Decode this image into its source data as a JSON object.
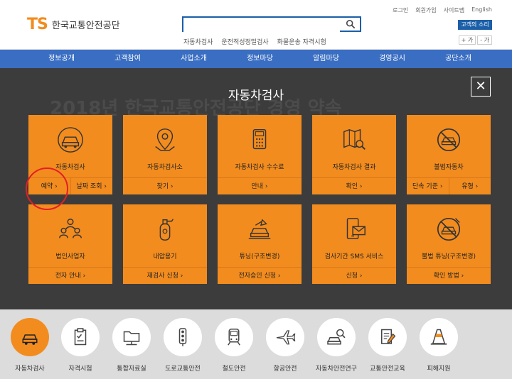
{
  "header": {
    "logo_mark": "TS",
    "logo_name": "한국교통안전공단",
    "search_value": "",
    "keywords": [
      "자동차검사",
      "운전적성정밀검사",
      "화물운송 자격시험"
    ],
    "util_links": [
      "로그인",
      "회원가입",
      "사이트맵",
      "English"
    ],
    "voice_button": "고객의 소리",
    "font_plus": "+ 가",
    "font_minus": "- 가"
  },
  "nav": [
    "정보공개",
    "고객참여",
    "사업소개",
    "정보마당",
    "알림마당",
    "경영공시",
    "공단소개"
  ],
  "overlay": {
    "background_text": "2018년 한국교통안전공단 경영 약속",
    "title": "자동차검사",
    "close_symbol": "✕",
    "tiles": [
      {
        "title": "자동차검사",
        "icon": "car-inspection-icon",
        "links": [
          "예약 ›",
          "날짜 조회 ›"
        ]
      },
      {
        "title": "자동차검사소",
        "icon": "map-pin-icon",
        "links": [
          "찾기 ›"
        ]
      },
      {
        "title": "자동차검사 수수료",
        "icon": "calculator-icon",
        "links": [
          "안내 ›"
        ]
      },
      {
        "title": "자동차검사 결과",
        "icon": "map-search-icon",
        "links": [
          "확인 ›"
        ]
      },
      {
        "title": "불법자동차",
        "icon": "no-car-icon",
        "links": [
          "단속 기준 ›",
          "유형 ›"
        ]
      },
      {
        "title": "법인사업자",
        "icon": "people-icon",
        "links": [
          "전자 안내 ›"
        ]
      },
      {
        "title": "내압용기",
        "icon": "gas-cylinder-icon",
        "links": [
          "재검사 신청 ›"
        ]
      },
      {
        "title": "튜닝(구조변경)",
        "icon": "tuning-car-icon",
        "links": [
          "전자승인 신청 ›"
        ]
      },
      {
        "title": "검사기간 SMS 서비스",
        "icon": "phone-mail-icon",
        "links": [
          "신청 ›"
        ]
      },
      {
        "title": "불법 튜닝(구조변경)",
        "icon": "no-tuning-icon",
        "links": [
          "확인 방법 ›"
        ]
      }
    ]
  },
  "quick_menu": [
    {
      "label": "자동차검사",
      "icon": "car-inspection-icon",
      "active": true
    },
    {
      "label": "자격시험",
      "icon": "clipboard-icon",
      "active": false
    },
    {
      "label": "통합자료실",
      "icon": "folder-network-icon",
      "active": false
    },
    {
      "label": "도로교통안전",
      "icon": "traffic-light-icon",
      "active": false
    },
    {
      "label": "철도안전",
      "icon": "train-icon",
      "active": false
    },
    {
      "label": "항공안전",
      "icon": "airplane-icon",
      "active": false
    },
    {
      "label": "자동차안전연구",
      "icon": "car-search-icon",
      "active": false
    },
    {
      "label": "교통안전교육",
      "icon": "document-edit-icon",
      "active": false
    },
    {
      "label": "피해지원",
      "icon": "traffic-cone-icon",
      "active": false
    }
  ],
  "colors": {
    "brand_blue": "#1b5fa8",
    "nav_blue": "#3a6ec2",
    "orange": "#f28c1e",
    "overlay": "#3c3c3c",
    "highlight_red": "#e41e26"
  }
}
